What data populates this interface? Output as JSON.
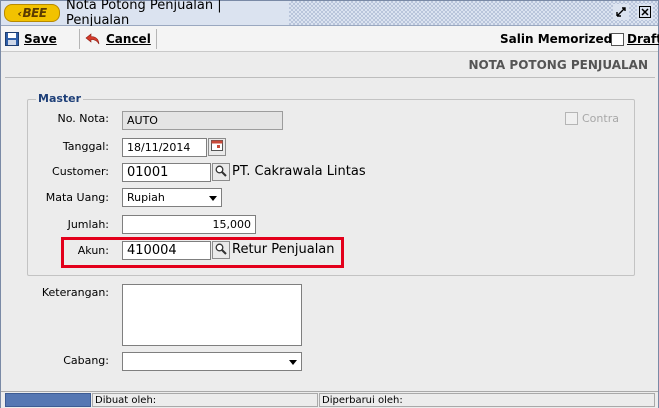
{
  "window": {
    "logo_text": "BEE",
    "title": "Nota Potong Penjualan | Penjualan",
    "restore_glyph": "⬋",
    "close_glyph": "✕"
  },
  "toolbar": {
    "save_label": "Save",
    "cancel_label": "Cancel",
    "salin_label": "Salin Memorized",
    "draft_label": "Draft"
  },
  "header": {
    "doc_title": "NOTA POTONG PENJUALAN"
  },
  "master": {
    "legend": "Master",
    "no_nota_label": "No. Nota:",
    "no_nota_value": "AUTO",
    "contra_label": "Contra",
    "tanggal_label": "Tanggal:",
    "tanggal_value": "18/11/2014",
    "customer_label": "Customer:",
    "customer_code": "01001",
    "customer_name": "PT. Cakrawala Lintas",
    "mata_uang_label": "Mata Uang:",
    "mata_uang_value": "Rupiah",
    "jumlah_label": "Jumlah:",
    "jumlah_value": "15,000",
    "akun_label": "Akun:",
    "akun_code": "410004",
    "akun_name": "Retur Penjualan"
  },
  "extra": {
    "keterangan_label": "Keterangan:",
    "keterangan_value": "",
    "cabang_label": "Cabang:",
    "cabang_value": ""
  },
  "status": {
    "dibuat_label": "Dibuat oleh:",
    "diperbarui_label": "Diperbarui oleh:"
  },
  "colors": {
    "accent_highlight": "#e3001b",
    "legend_text": "#1e3f78",
    "logo_fill": "#f2c200"
  }
}
